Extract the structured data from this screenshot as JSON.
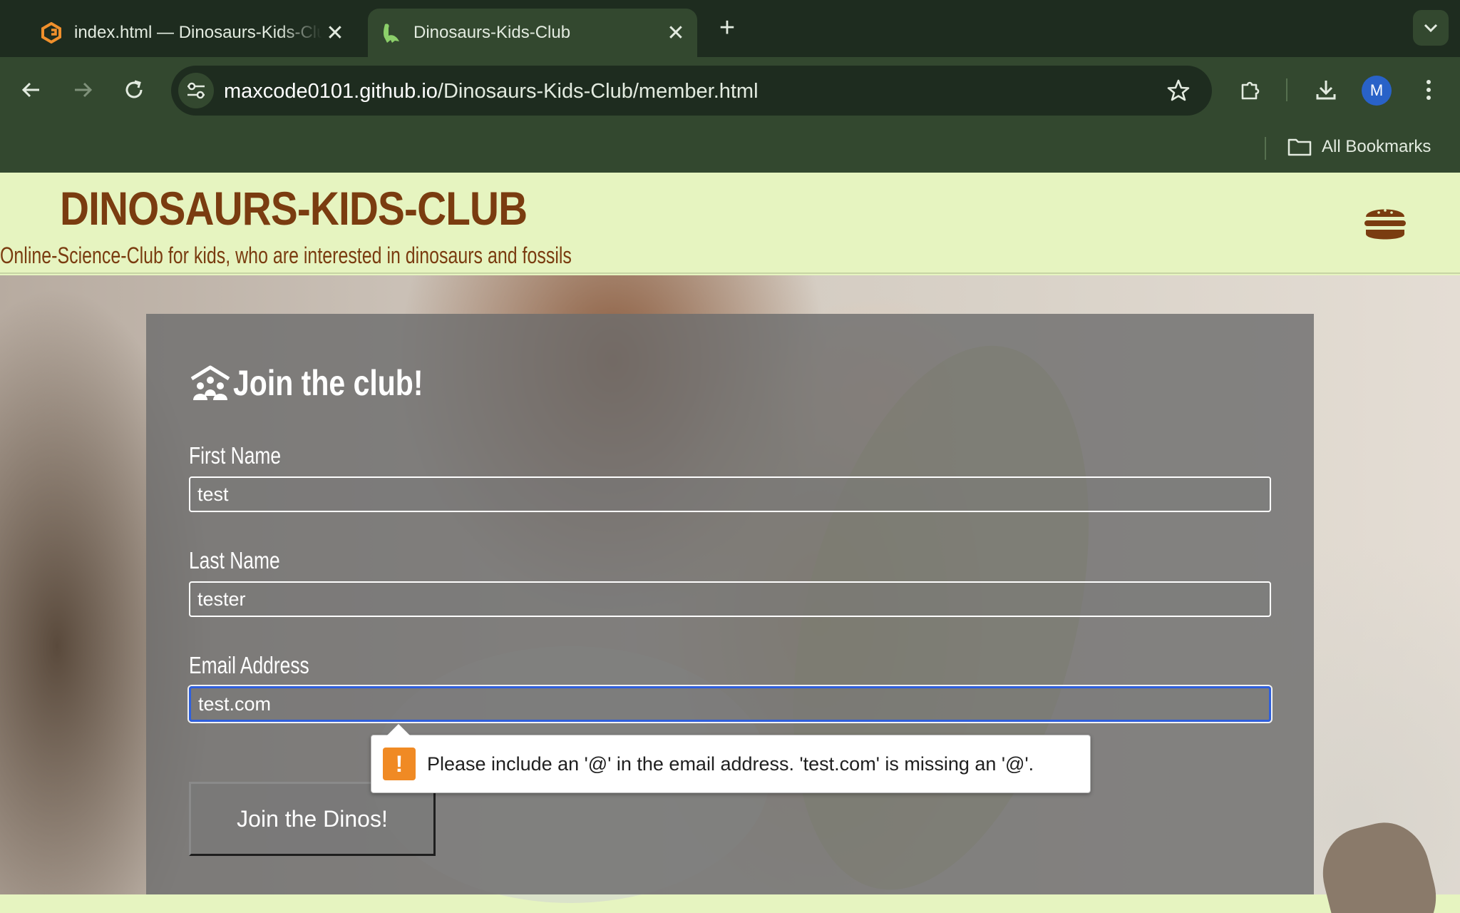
{
  "browser": {
    "tabs": [
      {
        "title": "index.html — Dinosaurs-Kids-Club",
        "favicon": "code-editor-favicon-icon",
        "active": false
      },
      {
        "title": "Dinosaurs-Kids-Club",
        "favicon": "dinosaur-favicon-icon",
        "active": true
      }
    ],
    "url": {
      "host": "maxcode0101.github.io",
      "path": "/Dinosaurs-Kids-Club/member.html"
    },
    "profile_initial": "M",
    "bookmarks_label": "All Bookmarks"
  },
  "site": {
    "brand": "DINOSAURS-KIDS-CLUB",
    "tagline": "Online-Science-Club for kids, who are interested in dinosaurs and fossils",
    "menu_icon": "hamburger-menu-icon"
  },
  "form": {
    "title": "Join the club!",
    "title_icon": "people-roof-icon",
    "fields": [
      {
        "label": "First Name",
        "value": "test"
      },
      {
        "label": "Last Name",
        "value": "tester"
      },
      {
        "label": "Email Address",
        "value": "test.com"
      }
    ],
    "submit_label": "Join the Dinos!",
    "validation_message": "Please include an '@' in the email address. 'test.com' is missing an '@'."
  },
  "colors": {
    "chrome_dark": "#1e2c1f",
    "chrome_toolbar": "#33482f",
    "page_bg": "#e6f4c0",
    "brand": "#7a3c10",
    "focus_ring": "#2f5fdc",
    "warning": "#f08a24"
  }
}
